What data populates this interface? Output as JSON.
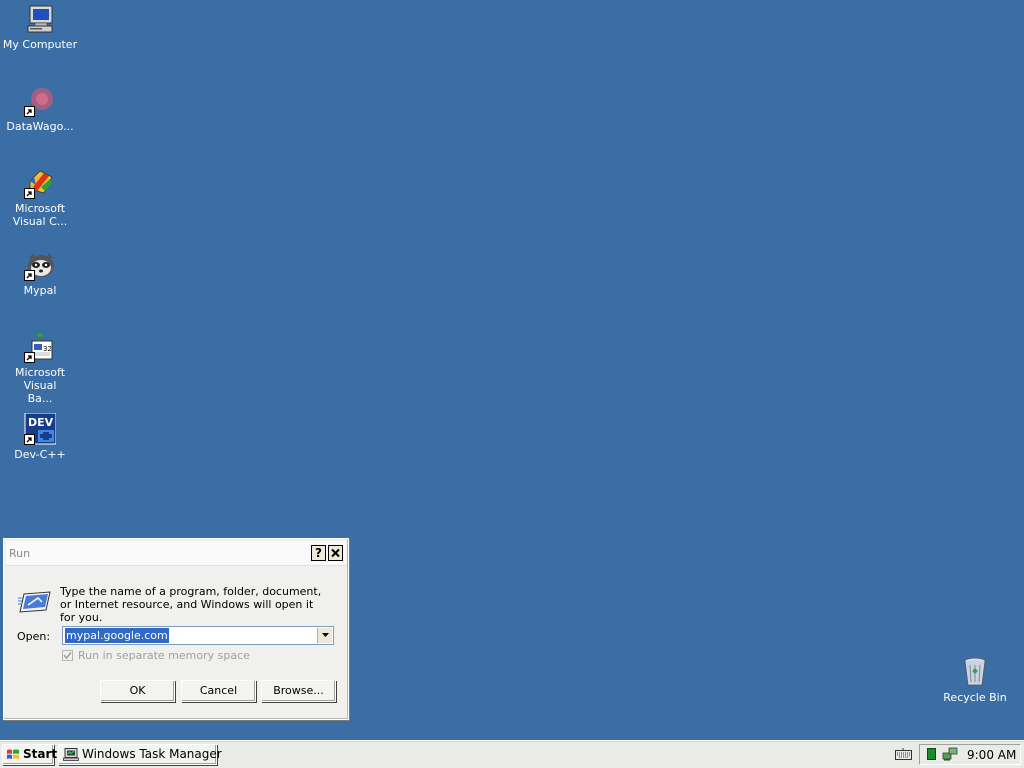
{
  "desktop": {
    "icons": [
      {
        "label": "My Computer",
        "icon": "my-computer-icon"
      },
      {
        "label": "DataWago...",
        "icon": "datawagon-icon"
      },
      {
        "label": "Microsoft Visual C...",
        "icon": "visual-cpp-icon"
      },
      {
        "label": "Mypal",
        "icon": "mypal-icon"
      },
      {
        "label": "Microsoft Visual Ba...",
        "icon": "visual-basic-icon"
      },
      {
        "label": "Dev-C++",
        "icon": "dev-cpp-icon"
      },
      {
        "label": "Recycle Bin",
        "icon": "recycle-bin-icon"
      }
    ],
    "background_color": "#3a6ea5"
  },
  "run_dialog": {
    "title": "Run",
    "help_glyph": "?",
    "close_glyph": "×",
    "description": "Type the name of a program, folder, document, or Internet resource, and Windows will open it for you.",
    "open_label": "Open:",
    "open_value": "mypal.google.com",
    "memory_checkbox_label": "Run in separate memory space",
    "memory_checkbox_checked": true,
    "memory_checkbox_disabled": true,
    "ok_label": "OK",
    "cancel_label": "Cancel",
    "browse_label": "Browse..."
  },
  "taskbar": {
    "start_label": "Start",
    "task_button_label": "Windows Task Manager",
    "clock": "9:00 AM"
  }
}
